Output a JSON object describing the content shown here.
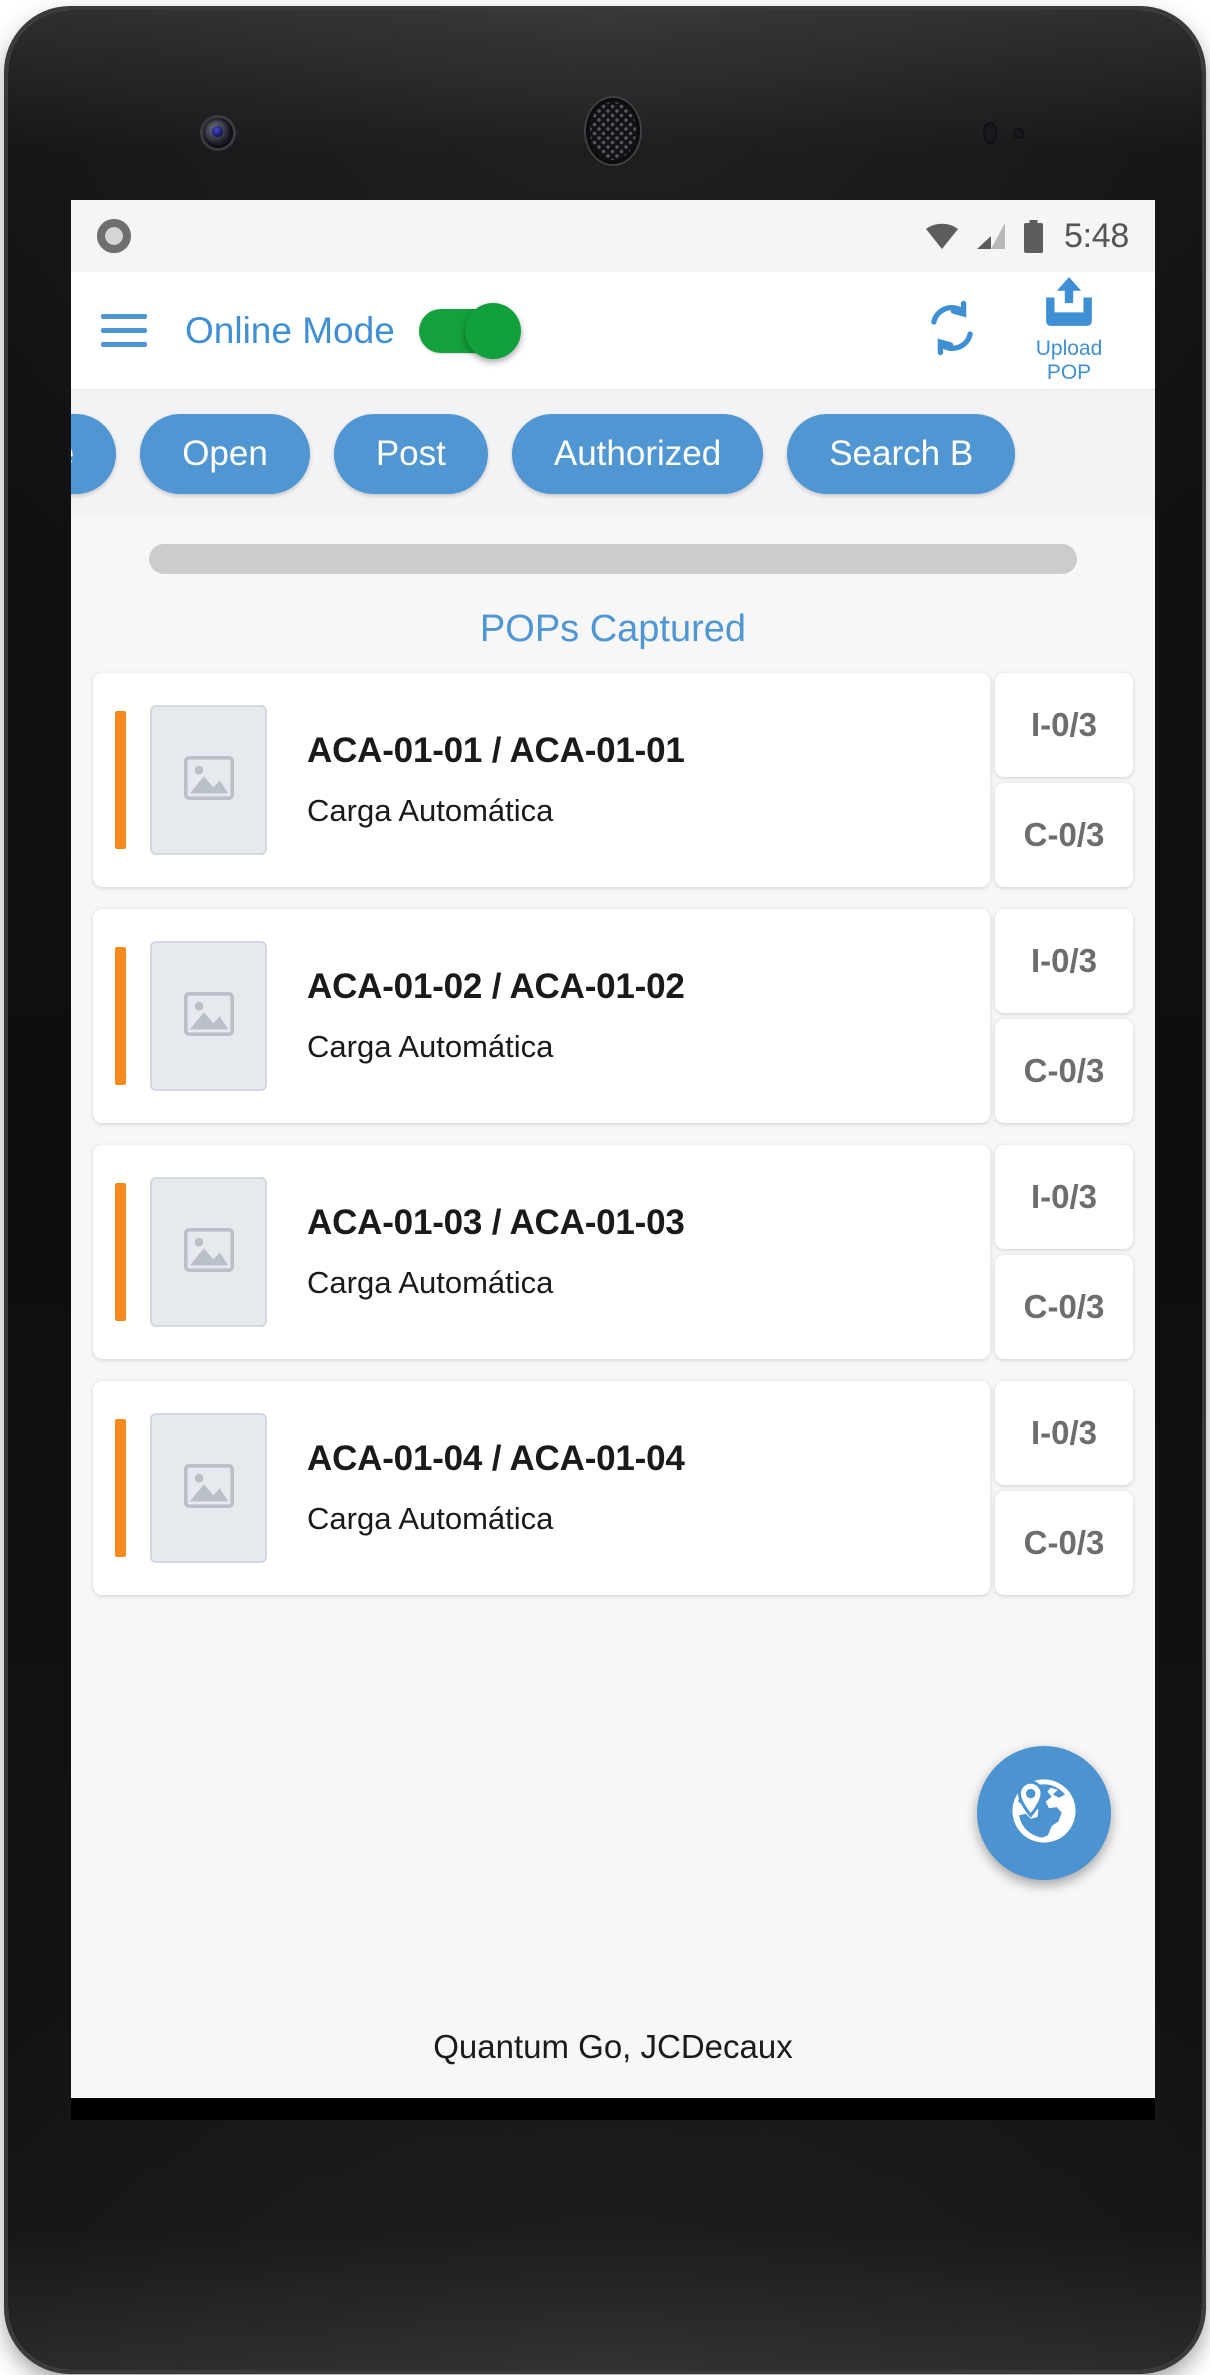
{
  "status_bar": {
    "time": "5:48",
    "icons": [
      "notification-dot",
      "wifi-icon",
      "signal-icon",
      "battery-icon"
    ]
  },
  "app_bar": {
    "menu_icon": "hamburger-menu-icon",
    "mode_label": "Online Mode",
    "toggle_on": true,
    "toggle_color": "#14a03c",
    "sync_icon": "sync-icon",
    "upload_icon": "upload-icon",
    "upload_line1": "Upload",
    "upload_line2": "POP",
    "accent_color": "#3f8fd4"
  },
  "filter_chips": [
    {
      "label": "te",
      "clipped": true
    },
    {
      "label": "Open",
      "clipped": false
    },
    {
      "label": "Post",
      "clipped": false
    },
    {
      "label": "Authorized",
      "clipped": false
    },
    {
      "label": "Search B",
      "clipped": false
    }
  ],
  "content": {
    "section_title": "POPs Captured",
    "accent_bar_color": "#f68a1e",
    "cards": [
      {
        "title": "ACA-01-01 / ACA-01-01",
        "subtitle": "Carga Automática",
        "thumb_icon": "image-placeholder-icon",
        "badge_top": "I-0/3",
        "badge_bottom": "C-0/3"
      },
      {
        "title": "ACA-01-02 / ACA-01-02",
        "subtitle": "Carga Automática",
        "thumb_icon": "image-placeholder-icon",
        "badge_top": "I-0/3",
        "badge_bottom": "C-0/3"
      },
      {
        "title": "ACA-01-03 / ACA-01-03",
        "subtitle": "Carga Automática",
        "thumb_icon": "image-placeholder-icon",
        "badge_top": "I-0/3",
        "badge_bottom": "C-0/3"
      },
      {
        "title": "ACA-01-04 / ACA-01-04",
        "subtitle": "Carga Automática",
        "thumb_icon": "image-placeholder-icon",
        "badge_top": "I-0/3",
        "badge_bottom": "C-0/3"
      }
    ],
    "fab_icon": "globe-location-icon",
    "fab_color": "#4b93d1"
  },
  "footer": {
    "text": "Quantum Go, JCDecaux"
  },
  "nav_bar": {
    "back": "back-triangle-icon",
    "home": "home-circle-icon",
    "recents": "recents-square-icon"
  }
}
